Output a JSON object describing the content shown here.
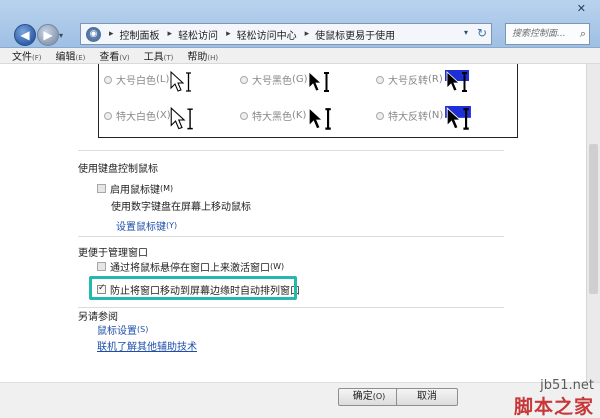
{
  "window": {
    "close_glyph": "✕"
  },
  "nav": {
    "back_glyph": "◀",
    "forward_glyph": "▶",
    "dropdown_glyph": "▾"
  },
  "address": {
    "crumbs": [
      "控制面板",
      "轻松访问",
      "轻松访问中心",
      "使鼠标更易于使用"
    ],
    "dropdown_glyph": "▾",
    "refresh_glyph": "↻"
  },
  "search": {
    "placeholder": "搜索控制面...",
    "icon": "search-icon",
    "glyph": "⌕"
  },
  "menu": [
    {
      "label": "文件",
      "key": "(F)"
    },
    {
      "label": "编辑",
      "key": "(E)"
    },
    {
      "label": "查看",
      "key": "(V)"
    },
    {
      "label": "工具",
      "key": "(T)"
    },
    {
      "label": "帮助",
      "key": "(H)"
    }
  ],
  "pointer_options": [
    {
      "label": "大号白色",
      "key": "(L)",
      "style": "white"
    },
    {
      "label": "大号黑色",
      "key": "(G)",
      "style": "black"
    },
    {
      "label": "大号反转",
      "key": "(R)",
      "style": "inverted"
    },
    {
      "label": "特大白色",
      "key": "(X)",
      "style": "white"
    },
    {
      "label": "特大黑色",
      "key": "(K)",
      "style": "black"
    },
    {
      "label": "特大反转",
      "key": "(N)",
      "style": "inverted"
    }
  ],
  "mouse_keys": {
    "title": "使用键盘控制鼠标",
    "enable_label": "启用鼠标键",
    "enable_key": "(M)",
    "enable_checked": false,
    "description": "使用数字键盘在屏幕上移动鼠标",
    "setup_link": "设置鼠标键",
    "setup_key": "(Y)"
  },
  "window_mgmt": {
    "title": "更便于管理窗口",
    "hover_label": "通过将鼠标悬停在窗口上来激活窗口",
    "hover_key": "(W)",
    "hover_checked": false,
    "snap_label": "防止将窗口移动到屏幕边缘时自动排列窗口",
    "snap_checked": true
  },
  "see_also": {
    "title": "另请参阅",
    "mouse_settings": "鼠标设置",
    "mouse_settings_key": "(S)",
    "online_link": "联机了解其他辅助技术"
  },
  "buttons": {
    "ok": "确定",
    "ok_key": "(O)",
    "cancel": "取消"
  },
  "watermark": {
    "site": "jb51.net",
    "brand": "脚本之家"
  },
  "colors": {
    "highlight": "#25b8ad",
    "link": "#1e4fa8",
    "invert_bg": "#1f2fd6"
  }
}
